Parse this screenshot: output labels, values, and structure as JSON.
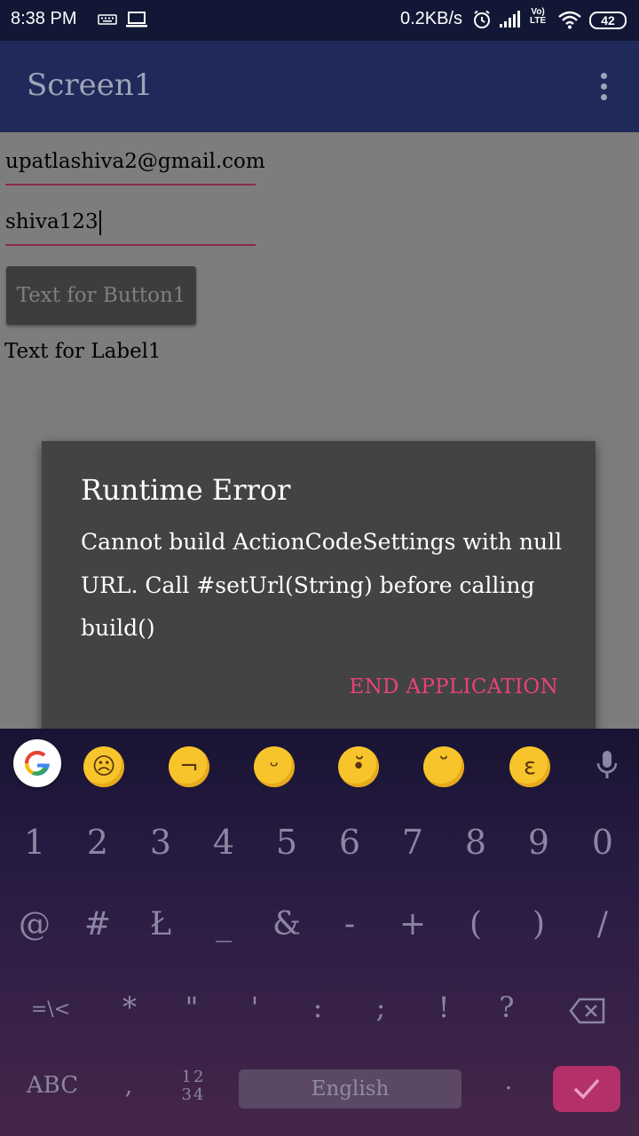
{
  "status_bar": {
    "time": "8:38 PM",
    "net_speed": "0.2KB/s",
    "volte_line1": "Vo)",
    "volte_line2": "LTE",
    "battery": "42",
    "icons": [
      "keyboard-icon",
      "laptop-icon",
      "alarm-icon",
      "signal-icon",
      "wifi-icon",
      "battery-icon"
    ]
  },
  "app_bar": {
    "title": "Screen1",
    "menu_icon": "more-vert-icon"
  },
  "form": {
    "email_value": "upatlashiva2@gmail.com",
    "password_value": "shiva123",
    "button_label": "Text for Button1",
    "label_text": "Text for Label1"
  },
  "dialog": {
    "title": "Runtime Error",
    "message": "Cannot build ActionCodeSettings with null URL. Call #setUrl(String) before calling build()",
    "action_label": "END APPLICATION",
    "action_color": "#e8427a"
  },
  "keyboard": {
    "suggestion_icons": [
      "google-icon",
      "frowning-emoji",
      "thinking-emoji",
      "grinning-emoji",
      "worried-emoji",
      "pensive-emoji",
      "kissing-emoji",
      "mic-icon"
    ],
    "number_row": [
      "1",
      "2",
      "3",
      "4",
      "5",
      "6",
      "7",
      "8",
      "9",
      "0"
    ],
    "symbol_row": [
      "@",
      "#",
      "Ł",
      "_",
      "&",
      "-",
      "+",
      "(",
      ")",
      "/"
    ],
    "symbol_row2": [
      "=\\<",
      "*",
      "\"",
      "'",
      ":",
      ";",
      "!",
      "?"
    ],
    "abc_label": "ABC",
    "comma": ",",
    "numpad_label_top": "12",
    "numpad_label_bottom": "34",
    "space_label": "English",
    "period": ".",
    "accent_color": "#b3306b"
  }
}
